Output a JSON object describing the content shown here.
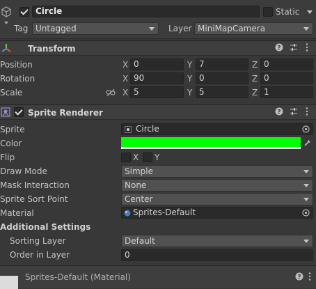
{
  "gameobject": {
    "name": "Circle",
    "static_label": "Static",
    "tag_label": "Tag",
    "tag_value": "Untagged",
    "layer_label": "Layer",
    "layer_value": "MiniMapCamera"
  },
  "transform": {
    "title": "Transform",
    "position": {
      "label": "Position",
      "x": "0",
      "y": "7",
      "z": "0"
    },
    "rotation": {
      "label": "Rotation",
      "x": "90",
      "y": "0",
      "z": "0"
    },
    "scale": {
      "label": "Scale",
      "x": "5",
      "y": "5",
      "z": "1"
    },
    "axis_x": "X",
    "axis_y": "Y",
    "axis_z": "Z"
  },
  "sprite_renderer": {
    "title": "Sprite Renderer",
    "sprite_label": "Sprite",
    "sprite_value": "Circle",
    "color_label": "Color",
    "color_value": "#00ff00",
    "flip_label": "Flip",
    "flip_x": "X",
    "flip_y": "Y",
    "draw_mode_label": "Draw Mode",
    "draw_mode_value": "Simple",
    "mask_label": "Mask Interaction",
    "mask_value": "None",
    "sort_point_label": "Sprite Sort Point",
    "sort_point_value": "Center",
    "material_label": "Material",
    "material_value": "Sprites-Default",
    "additional_settings": "Additional Settings",
    "sorting_layer_label": "Sorting Layer",
    "sorting_layer_value": "Default",
    "order_label": "Order in Layer",
    "order_value": "0"
  },
  "material_footer": {
    "title": "Sprites-Default (Material)"
  },
  "icons": {
    "help": "question-circle-icon",
    "presets": "sliders-icon",
    "more": "kebab-menu-icon"
  },
  "colors": {
    "background": "#383838",
    "header": "#3e3e3e",
    "field": "#2a2a2a",
    "dropdown": "#515151",
    "color_swatch": "#00ff00"
  }
}
